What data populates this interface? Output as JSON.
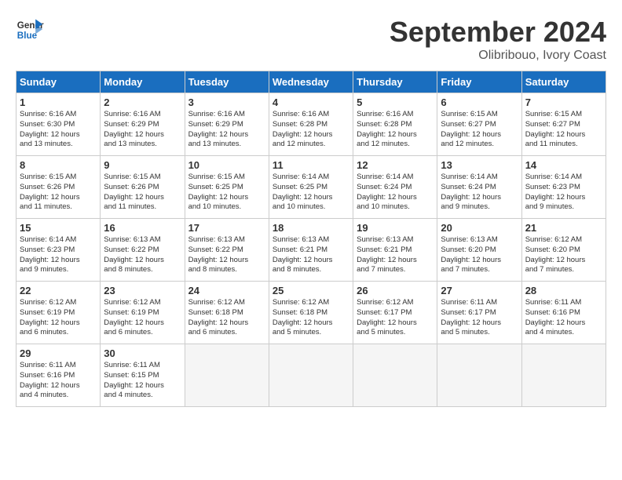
{
  "header": {
    "logo_line1": "General",
    "logo_line2": "Blue",
    "month": "September 2024",
    "location": "Olibribouo, Ivory Coast"
  },
  "days_of_week": [
    "Sunday",
    "Monday",
    "Tuesday",
    "Wednesday",
    "Thursday",
    "Friday",
    "Saturday"
  ],
  "weeks": [
    [
      {
        "num": "1",
        "info": "Sunrise: 6:16 AM\nSunset: 6:30 PM\nDaylight: 12 hours\nand 13 minutes."
      },
      {
        "num": "2",
        "info": "Sunrise: 6:16 AM\nSunset: 6:29 PM\nDaylight: 12 hours\nand 13 minutes."
      },
      {
        "num": "3",
        "info": "Sunrise: 6:16 AM\nSunset: 6:29 PM\nDaylight: 12 hours\nand 13 minutes."
      },
      {
        "num": "4",
        "info": "Sunrise: 6:16 AM\nSunset: 6:28 PM\nDaylight: 12 hours\nand 12 minutes."
      },
      {
        "num": "5",
        "info": "Sunrise: 6:16 AM\nSunset: 6:28 PM\nDaylight: 12 hours\nand 12 minutes."
      },
      {
        "num": "6",
        "info": "Sunrise: 6:15 AM\nSunset: 6:27 PM\nDaylight: 12 hours\nand 12 minutes."
      },
      {
        "num": "7",
        "info": "Sunrise: 6:15 AM\nSunset: 6:27 PM\nDaylight: 12 hours\nand 11 minutes."
      }
    ],
    [
      {
        "num": "8",
        "info": "Sunrise: 6:15 AM\nSunset: 6:26 PM\nDaylight: 12 hours\nand 11 minutes."
      },
      {
        "num": "9",
        "info": "Sunrise: 6:15 AM\nSunset: 6:26 PM\nDaylight: 12 hours\nand 11 minutes."
      },
      {
        "num": "10",
        "info": "Sunrise: 6:15 AM\nSunset: 6:25 PM\nDaylight: 12 hours\nand 10 minutes."
      },
      {
        "num": "11",
        "info": "Sunrise: 6:14 AM\nSunset: 6:25 PM\nDaylight: 12 hours\nand 10 minutes."
      },
      {
        "num": "12",
        "info": "Sunrise: 6:14 AM\nSunset: 6:24 PM\nDaylight: 12 hours\nand 10 minutes."
      },
      {
        "num": "13",
        "info": "Sunrise: 6:14 AM\nSunset: 6:24 PM\nDaylight: 12 hours\nand 9 minutes."
      },
      {
        "num": "14",
        "info": "Sunrise: 6:14 AM\nSunset: 6:23 PM\nDaylight: 12 hours\nand 9 minutes."
      }
    ],
    [
      {
        "num": "15",
        "info": "Sunrise: 6:14 AM\nSunset: 6:23 PM\nDaylight: 12 hours\nand 9 minutes."
      },
      {
        "num": "16",
        "info": "Sunrise: 6:13 AM\nSunset: 6:22 PM\nDaylight: 12 hours\nand 8 minutes."
      },
      {
        "num": "17",
        "info": "Sunrise: 6:13 AM\nSunset: 6:22 PM\nDaylight: 12 hours\nand 8 minutes."
      },
      {
        "num": "18",
        "info": "Sunrise: 6:13 AM\nSunset: 6:21 PM\nDaylight: 12 hours\nand 8 minutes."
      },
      {
        "num": "19",
        "info": "Sunrise: 6:13 AM\nSunset: 6:21 PM\nDaylight: 12 hours\nand 7 minutes."
      },
      {
        "num": "20",
        "info": "Sunrise: 6:13 AM\nSunset: 6:20 PM\nDaylight: 12 hours\nand 7 minutes."
      },
      {
        "num": "21",
        "info": "Sunrise: 6:12 AM\nSunset: 6:20 PM\nDaylight: 12 hours\nand 7 minutes."
      }
    ],
    [
      {
        "num": "22",
        "info": "Sunrise: 6:12 AM\nSunset: 6:19 PM\nDaylight: 12 hours\nand 6 minutes."
      },
      {
        "num": "23",
        "info": "Sunrise: 6:12 AM\nSunset: 6:19 PM\nDaylight: 12 hours\nand 6 minutes."
      },
      {
        "num": "24",
        "info": "Sunrise: 6:12 AM\nSunset: 6:18 PM\nDaylight: 12 hours\nand 6 minutes."
      },
      {
        "num": "25",
        "info": "Sunrise: 6:12 AM\nSunset: 6:18 PM\nDaylight: 12 hours\nand 5 minutes."
      },
      {
        "num": "26",
        "info": "Sunrise: 6:12 AM\nSunset: 6:17 PM\nDaylight: 12 hours\nand 5 minutes."
      },
      {
        "num": "27",
        "info": "Sunrise: 6:11 AM\nSunset: 6:17 PM\nDaylight: 12 hours\nand 5 minutes."
      },
      {
        "num": "28",
        "info": "Sunrise: 6:11 AM\nSunset: 6:16 PM\nDaylight: 12 hours\nand 4 minutes."
      }
    ],
    [
      {
        "num": "29",
        "info": "Sunrise: 6:11 AM\nSunset: 6:16 PM\nDaylight: 12 hours\nand 4 minutes."
      },
      {
        "num": "30",
        "info": "Sunrise: 6:11 AM\nSunset: 6:15 PM\nDaylight: 12 hours\nand 4 minutes."
      },
      {
        "num": "",
        "info": ""
      },
      {
        "num": "",
        "info": ""
      },
      {
        "num": "",
        "info": ""
      },
      {
        "num": "",
        "info": ""
      },
      {
        "num": "",
        "info": ""
      }
    ]
  ]
}
